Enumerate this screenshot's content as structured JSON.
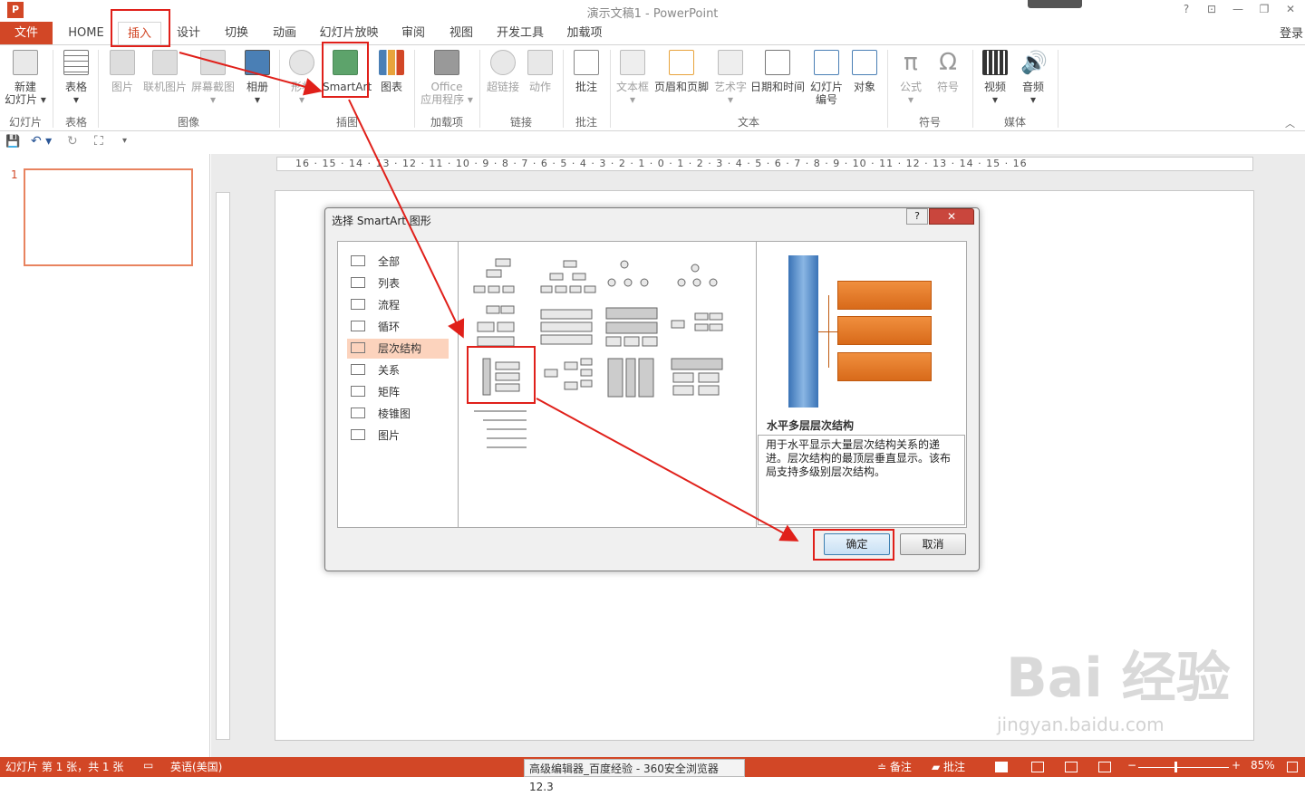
{
  "window": {
    "title": "演示文稿1 - PowerPoint",
    "logo": "P",
    "controls": [
      "?",
      "⊡",
      "—",
      "❐",
      "✕"
    ]
  },
  "tabs": {
    "file": "文件",
    "items": [
      "HOME",
      "插入",
      "设计",
      "切换",
      "动画",
      "幻灯片放映",
      "审阅",
      "视图",
      "开发工具",
      "加载项"
    ],
    "login": "登录"
  },
  "ribbon": {
    "buttons": [
      {
        "label": "新建\n幻灯片 ▾",
        "icon": "new-slide-icon"
      },
      {
        "label": "表格\n▾",
        "icon": "table-icon"
      },
      {
        "label": "图片",
        "icon": "picture-icon"
      },
      {
        "label": "联机图片",
        "icon": "online-picture-icon"
      },
      {
        "label": "屏幕截图\n▾",
        "icon": "screenshot-icon"
      },
      {
        "label": "相册\n▾",
        "icon": "album-icon"
      },
      {
        "label": "形状\n▾",
        "icon": "shapes-icon"
      },
      {
        "label": "SmartArt",
        "icon": "smartart-icon"
      },
      {
        "label": "图表",
        "icon": "chart-icon"
      },
      {
        "label": "Office\n应用程序 ▾",
        "icon": "office-apps-icon"
      },
      {
        "label": "超链接",
        "icon": "hyperlink-icon"
      },
      {
        "label": "动作",
        "icon": "action-icon"
      },
      {
        "label": "批注",
        "icon": "comment-icon"
      },
      {
        "label": "文本框\n▾",
        "icon": "textbox-icon"
      },
      {
        "label": "页眉和页脚",
        "icon": "header-footer-icon"
      },
      {
        "label": "艺术字\n▾",
        "icon": "wordart-icon"
      },
      {
        "label": "日期和时间",
        "icon": "datetime-icon"
      },
      {
        "label": "幻灯片\n编号",
        "icon": "slide-number-icon"
      },
      {
        "label": "对象",
        "icon": "object-icon"
      },
      {
        "label": "公式\n▾",
        "icon": "equation-icon"
      },
      {
        "label": "符号",
        "icon": "symbol-icon"
      },
      {
        "label": "视频\n▾",
        "icon": "video-icon"
      },
      {
        "label": "音频\n▾",
        "icon": "audio-icon"
      }
    ],
    "groups": [
      "幻灯片",
      "表格",
      "图像",
      "插图",
      "加载项",
      "链接",
      "批注",
      "文本",
      "符号",
      "媒体"
    ]
  },
  "qat": {
    "save": "💾",
    "undo": "↶ ▾",
    "redo": "↻",
    "present": "⛶",
    "more": "▾"
  },
  "thumbnail": {
    "number": "1"
  },
  "ruler": {
    "marks": "16 · 15 · 14 · 13 · 12 · 11 · 10 · 9 · 8 · 7 · 6 · 5 · 4 · 3 · 2 · 1 · 0 · 1 · 2 · 3 · 4 · 5 · 6 · 7 · 8 · 9 · 10 · 11 · 12 · 13 · 14 · 15 · 16"
  },
  "dialog": {
    "title": "选择 SmartArt 图形",
    "help": "?",
    "close": "✕",
    "categories": [
      "全部",
      "列表",
      "流程",
      "循环",
      "层次结构",
      "关系",
      "矩阵",
      "棱锥图",
      "图片"
    ],
    "selected_category": "层次结构",
    "preview_title": "水平多层层次结构",
    "preview_desc": "用于水平显示大量层次结构关系的递进。层次结构的最顶层垂直显示。该布局支持多级别层次结构。",
    "ok": "确定",
    "cancel": "取消"
  },
  "status": {
    "slide": "幻灯片 第 1 张，共 1 张",
    "lang": "英语(美国)",
    "notes": "备注",
    "comments": "批注",
    "zoom": "85%"
  },
  "taskbar_tip": "高级编辑器_百度经验 - 360安全浏览器 12.3",
  "watermark": {
    "brand": "Bai 经验",
    "url": "jingyan.baidu.com"
  },
  "colors": {
    "accent": "#d24726",
    "highlight": "#e0201a",
    "smartart_orange": "#e0701f",
    "smartart_blue": "#3e7cc0"
  }
}
